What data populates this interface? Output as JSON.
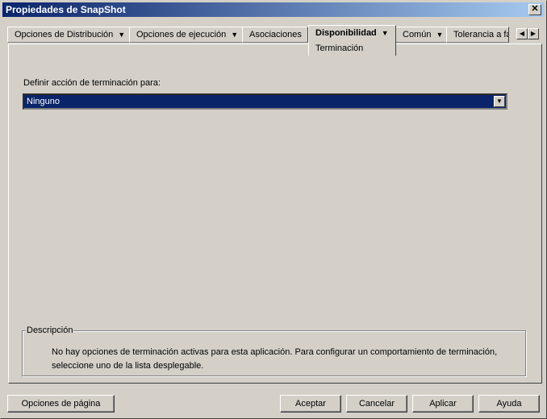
{
  "window": {
    "title": "Propiedades de SnapShot",
    "close_glyph": "✕"
  },
  "tabs": [
    {
      "label": "Opciones de Distribución",
      "arrow": "▼"
    },
    {
      "label": "Opciones de ejecución",
      "arrow": "▼"
    },
    {
      "label": "Asociaciones"
    },
    {
      "label": "Disponibilidad",
      "arrow": "▼",
      "sub": "Terminación"
    },
    {
      "label": "Común",
      "arrow": "▼"
    },
    {
      "label": "Tolerancia a fa"
    }
  ],
  "tab_nav": {
    "left_glyph": "◀",
    "right_glyph": "▶"
  },
  "form": {
    "label": "Definir acción de terminación para:",
    "select_value": "Ninguno",
    "select_arrow": "▼"
  },
  "description": {
    "legend": "Descripción",
    "text": "No hay opciones de terminación activas para esta aplicación. Para configurar un comportamiento de terminación, seleccione uno de la lista desplegable."
  },
  "buttons": {
    "page_options": "Opciones de página",
    "accept": "Aceptar",
    "cancel": "Cancelar",
    "apply": "Aplicar",
    "help": "Ayuda"
  }
}
